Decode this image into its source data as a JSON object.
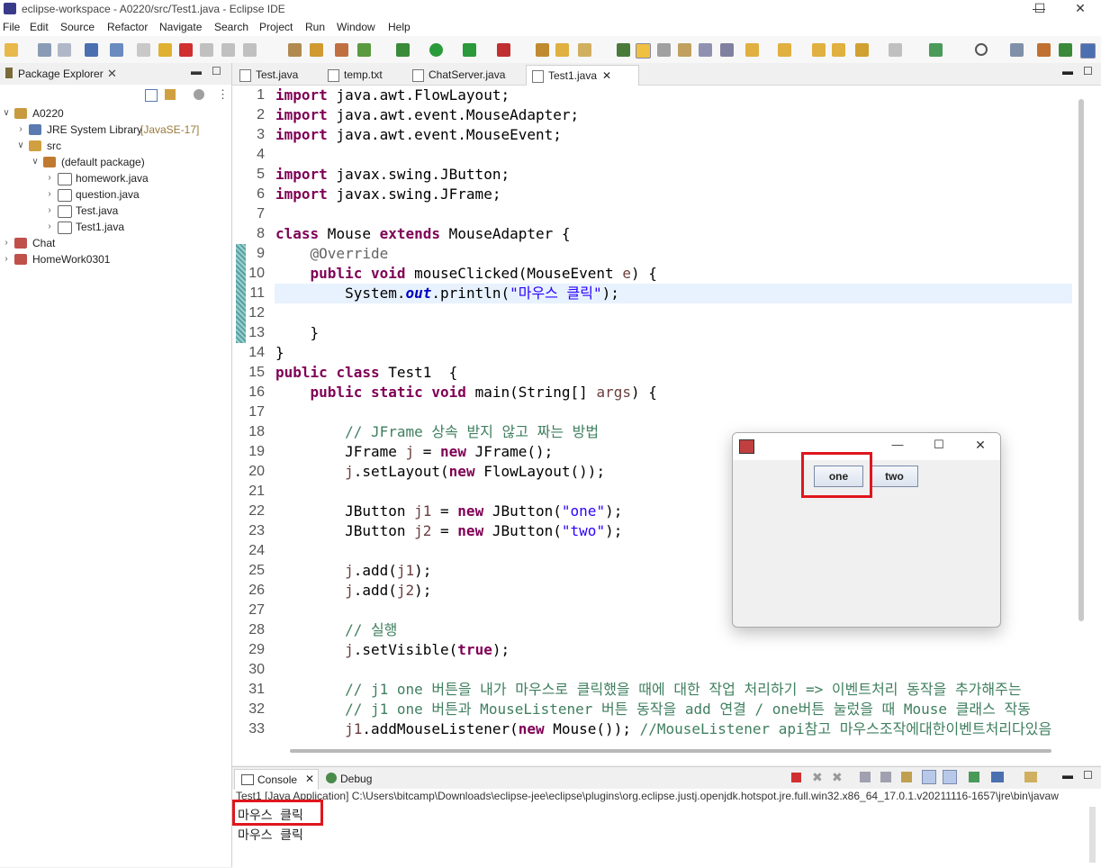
{
  "window": {
    "title": "eclipse-workspace - A0220/src/Test1.java - Eclipse IDE"
  },
  "menu": [
    "File",
    "Edit",
    "Source",
    "Refactor",
    "Navigate",
    "Search",
    "Project",
    "Run",
    "Window",
    "Help"
  ],
  "package_explorer": {
    "title": "Package Explorer",
    "tree": [
      {
        "label": "A0220",
        "suffix": ""
      },
      {
        "label": "JRE System Library",
        "suffix": "[JavaSE-17]"
      },
      {
        "label": "src",
        "suffix": ""
      },
      {
        "label": "(default package)",
        "suffix": ""
      },
      {
        "label": "homework.java",
        "suffix": ""
      },
      {
        "label": "question.java",
        "suffix": ""
      },
      {
        "label": "Test.java",
        "suffix": ""
      },
      {
        "label": "Test1.java",
        "suffix": ""
      },
      {
        "label": "Chat",
        "suffix": ""
      },
      {
        "label": "HomeWork0301",
        "suffix": ""
      }
    ]
  },
  "editor": {
    "tabs": [
      "Test.java",
      "temp.txt",
      "ChatServer.java",
      "Test1.java"
    ],
    "active_tab": "Test1.java",
    "line_numbers": [
      "1",
      "2",
      "3",
      "4",
      "5",
      "6",
      "7",
      "8",
      "9",
      "10",
      "11",
      "12",
      "13",
      "14",
      "15",
      "16",
      "17",
      "18",
      "19",
      "20",
      "21",
      "22",
      "23",
      "24",
      "25",
      "26",
      "27",
      "28",
      "29",
      "30",
      "31",
      "32",
      "33"
    ]
  },
  "console": {
    "tabs": [
      "Console",
      "Debug"
    ],
    "header": "Test1 [Java Application] C:\\Users\\bitcamp\\Downloads\\eclipse-jee\\eclipse\\plugins\\org.eclipse.justj.openjdk.hotspot.jre.full.win32.x86_64_17.0.1.v20211116-1657\\jre\\bin\\javaw",
    "output": [
      "마우스 클릭",
      "마우스 클릭"
    ]
  },
  "jframe": {
    "buttons": [
      "one",
      "two"
    ]
  },
  "colors": {
    "highlight": "#e0161d",
    "keyword": "#7f0055",
    "string": "#2a00ff",
    "comment": "#3f7f5f"
  }
}
